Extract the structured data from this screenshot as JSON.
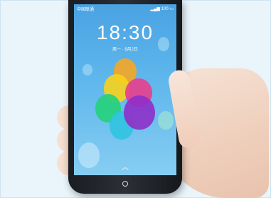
{
  "photo": {
    "subject": "smartphone-held-in-hand",
    "status_bar": {
      "carrier": "中国联通",
      "battery": "100"
    },
    "lock_screen": {
      "time": "18:30",
      "date": "周一 · 9月2日"
    },
    "colors": {
      "wallpaper": "#5fb7ec",
      "balloon_orange": "#f5a623",
      "balloon_yellow": "#f8d21c",
      "balloon_pink": "#e83e8c",
      "balloon_purple": "#8e2fc8",
      "balloon_green": "#25d07a",
      "balloon_cyan": "#31c3e0",
      "phone_body": "#1f2328"
    }
  }
}
